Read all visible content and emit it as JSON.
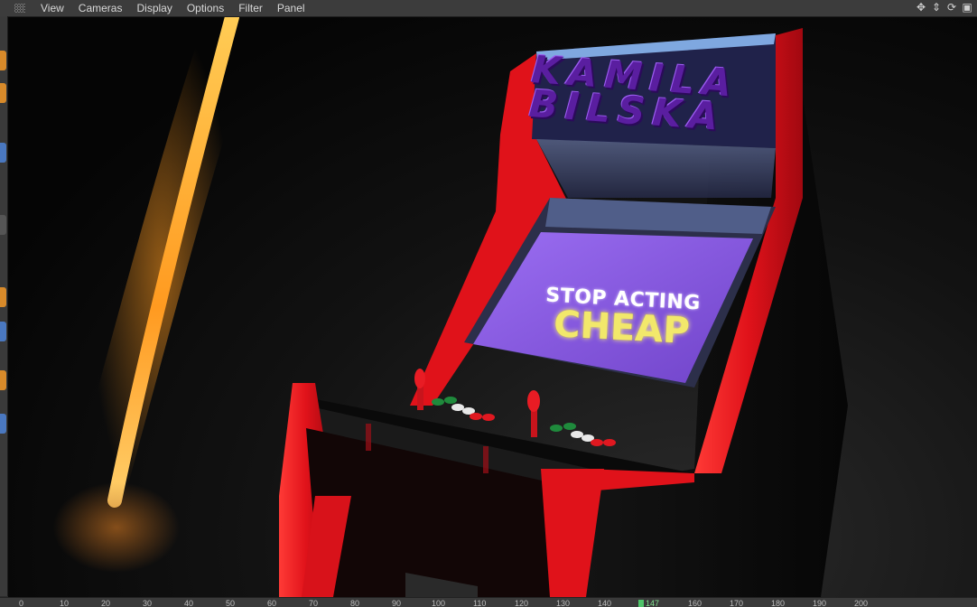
{
  "menubar": {
    "items": [
      "View",
      "Cameras",
      "Display",
      "Options",
      "Filter",
      "Panel"
    ],
    "right_icons": [
      "move-icon",
      "vertical-move-icon",
      "rotate-icon",
      "maximize-icon"
    ]
  },
  "left_tools": [
    "cube-tool-icon",
    "spline-tool-icon",
    "nurbs-tool-icon",
    "deformer-tool-icon",
    "light-tool-icon",
    "camera-tool-icon",
    "render-tool-icon",
    "material-tool-icon"
  ],
  "scene": {
    "marquee": {
      "line1": "KAMILA",
      "line2": "BILSKA"
    },
    "screen": {
      "line1": "STOP ACTING",
      "line2": "CHEAP"
    }
  },
  "timeline": {
    "ticks": [
      "0",
      "10",
      "20",
      "30",
      "40",
      "50",
      "60",
      "70",
      "80",
      "90",
      "100",
      "110",
      "120",
      "130",
      "140",
      "147",
      "160",
      "170",
      "180",
      "190",
      "200"
    ],
    "current_frame": "147"
  },
  "colors": {
    "accent": "#4fc46a",
    "cabinet_red": "#e2141a",
    "screen_purple": "#8a5ae0",
    "light_beam": "#ffb13b"
  }
}
